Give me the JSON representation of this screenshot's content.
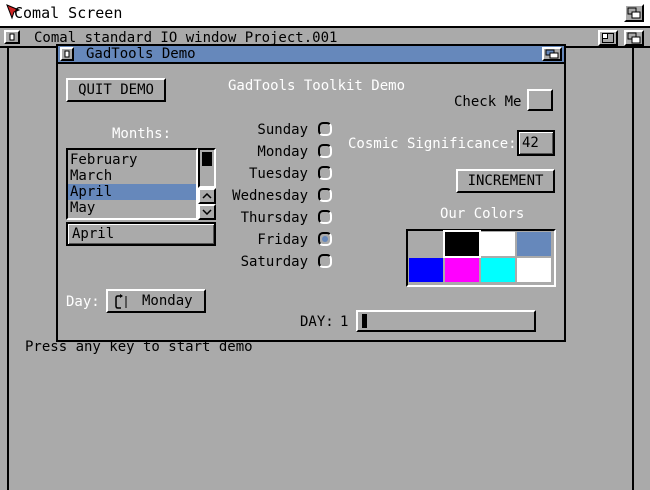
{
  "screen": {
    "title": "Comal Screen"
  },
  "io_window": {
    "title": "Comal standard IO window  Project.001",
    "prompt": "Press any key to start demo"
  },
  "demo": {
    "title": "GadTools Demo",
    "quit_label": "QUIT DEMO",
    "heading": "GadTools Toolkit Demo",
    "checkbox_label": "Check Me",
    "months_label": "Months:",
    "months": [
      "February",
      "March",
      "April",
      "May"
    ],
    "selected_month": "April",
    "days": [
      "Sunday",
      "Monday",
      "Tuesday",
      "Wednesday",
      "Thursday",
      "Friday",
      "Saturday"
    ],
    "selected_day": "Friday",
    "integer_label": "Cosmic Significance:",
    "integer_value": "42",
    "increment_label": "INCREMENT",
    "palette_label": "Our Colors",
    "palette": [
      "#aaaaaa",
      "#000000",
      "#ffffff",
      "#6688bb",
      "#0000ff",
      "#ff00ff",
      "#00ffff",
      "#ffffff"
    ],
    "cycle_label": "Day:",
    "cycle_value": "Monday",
    "slider_label": "DAY:",
    "slider_value": "1"
  }
}
